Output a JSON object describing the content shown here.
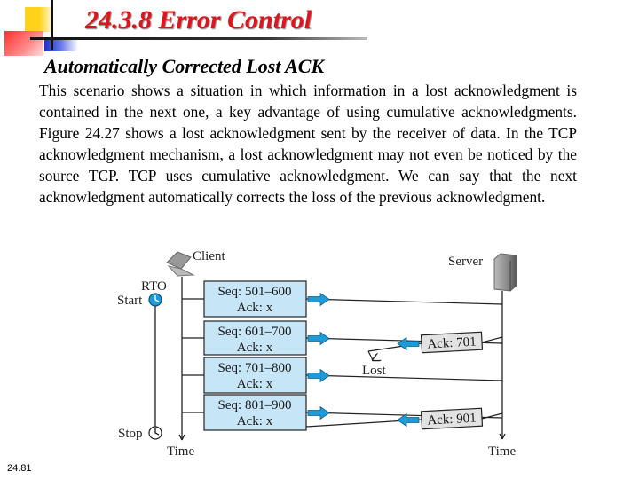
{
  "slide": {
    "title": "24.3.8  Error Control",
    "subtitle": "Automatically Corrected Lost ACK",
    "body": "This scenario shows a situation in which information in a lost acknowledgment is contained in the next one, a key advantage of using cumulative acknowledgments. Figure 24.27 shows a lost acknowledgment sent by the receiver of data. In the TCP acknowledgment mechanism, a lost acknowledgment may not even be noticed by the source TCP. TCP uses cumulative acknowledgment. We can say that the next acknowledgment automatically corrects the loss of the previous acknowledgment.",
    "page_number": "24.81"
  },
  "diagram": {
    "client_label": "Client",
    "server_label": "Server",
    "rto_label": "RTO",
    "start_label": "Start",
    "stop_label": "Stop",
    "time_label_client": "Time",
    "time_label_server": "Time",
    "lost_label": "Lost",
    "segments": [
      {
        "seq": "Seq: 501–600",
        "ack": "Ack: x"
      },
      {
        "seq": "Seq: 601–700",
        "ack": "Ack: x"
      },
      {
        "seq": "Seq: 701–800",
        "ack": "Ack: x"
      },
      {
        "seq": "Seq: 801–900",
        "ack": "Ack: x"
      }
    ],
    "acks": [
      {
        "label": "Ack: 701",
        "status": "lost"
      },
      {
        "label": "Ack: 901",
        "status": "delivered"
      }
    ],
    "colors": {
      "title": "#e0141c",
      "segment_fill": "#c6e6f7",
      "arrow": "#1e9bd7",
      "ack_fill": "#e2e2e2",
      "clock": "#1e9bd7"
    }
  }
}
